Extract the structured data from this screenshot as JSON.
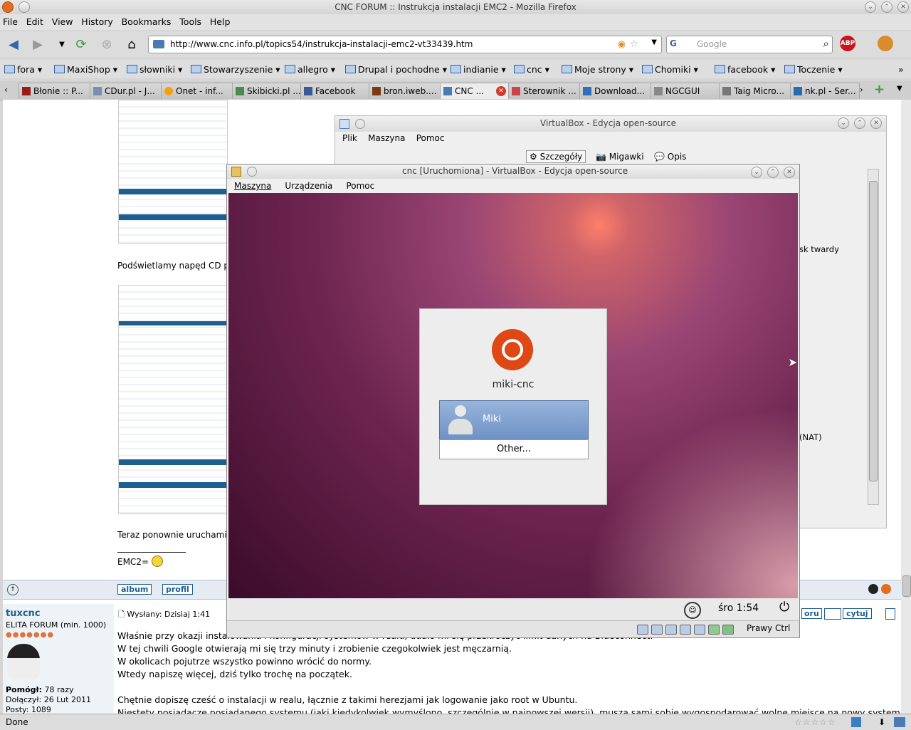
{
  "firefox": {
    "title": "CNC FORUM :: Instrukcja instalacji EMC2 - Mozilla Firefox",
    "menu": [
      "File",
      "Edit",
      "View",
      "History",
      "Bookmarks",
      "Tools",
      "Help"
    ],
    "url": "http://www.cnc.info.pl/topics54/instrukcja-instalacji-emc2-vt33439.htm",
    "search_placeholder": "Google",
    "bookmarks": [
      "fora",
      "MaxiShop",
      "słowniki",
      "Stowarzyszenie",
      "allegro",
      "Drupal i pochodne",
      "indianie",
      "cnc",
      "Moje strony",
      "Chomiki",
      "facebook",
      "Toczenie"
    ],
    "tabs": [
      "Błonie :: P...",
      "CDur.pl - J...",
      "Onet - inf...",
      "Skibicki.pl ...",
      "Facebook",
      "bron.iweb....",
      "CNC ...",
      "Sterownik ...",
      "Download...",
      "NGCGUI",
      "Taig Micro...",
      "nk.pl - Ser..."
    ],
    "status": "Done"
  },
  "forum": {
    "text_partial_1": "Podświetlamy napęd CD p",
    "text_partial_2": "Teraz ponownie uruchami",
    "underline": "________________",
    "emc2": "EMC2=",
    "buttons": {
      "album": "album",
      "profil": "profil",
      "cytuj": "cytuj",
      "odpowiedz": "oru"
    },
    "author": {
      "name": "tuxcnc",
      "rank": "ELITA FORUM (min. 1000)",
      "helped_label": "Pomógł:",
      "helped_value": "78 razy",
      "joined_label": "Dołączył:",
      "joined_value": "26 Lut 2011",
      "posts_label": "Posty:",
      "posts_value": "1089"
    },
    "post_time": "Wysłany: Dzisiaj 1:41",
    "post_lines": [
      "Właśnie przy okazji instalowania i konfiguracji systemów w realu, udało mi się przekroczyć limit danych na Blueconnect.",
      "W tej chwili Google otwierają mi się trzy minuty i zrobienie czegokolwiek jest męczarnią.",
      "W okolicach pojutrze wszystko powinno wrócić do normy.",
      "Wtedy napiszę więcej, dziś tylko trochę na początek.",
      "",
      "Chętnie dopiszę cześć o instalacji w realu, łącznie z takimi herezjami jak logowanie jako root w Ubuntu.",
      "Niestety posiadacze posiadanego systemu (jaki kiedykolwiek wymyślono, szczególnie w najnowszej wersji), muszą sami sobie wygospodarować wolne miejsce na nowy system."
    ]
  },
  "vbox_manager": {
    "title": "VirtualBox - Edycja open-source",
    "menu": [
      "Plik",
      "Maszyna",
      "Pomoc"
    ],
    "tabs": [
      "Szczegóły",
      "Migawki",
      "Opis"
    ],
    "text_dysk": "sk twardy",
    "text_nat": "(NAT)"
  },
  "vm_window": {
    "title": "cnc [Uruchomiona] - VirtualBox - Edycja open-source",
    "menu": [
      "Maszyna",
      "Urządzenia",
      "Pomoc"
    ],
    "hostname": "miki-cnc",
    "users": [
      "Miki"
    ],
    "other": "Other...",
    "clock": "śro  1:54",
    "host_key": "Prawy Ctrl"
  },
  "colors": {
    "ubuntu_orange": "#dd4814",
    "selection_blue": "#7e9fcf",
    "forum_blue": "#1d5f8f"
  }
}
